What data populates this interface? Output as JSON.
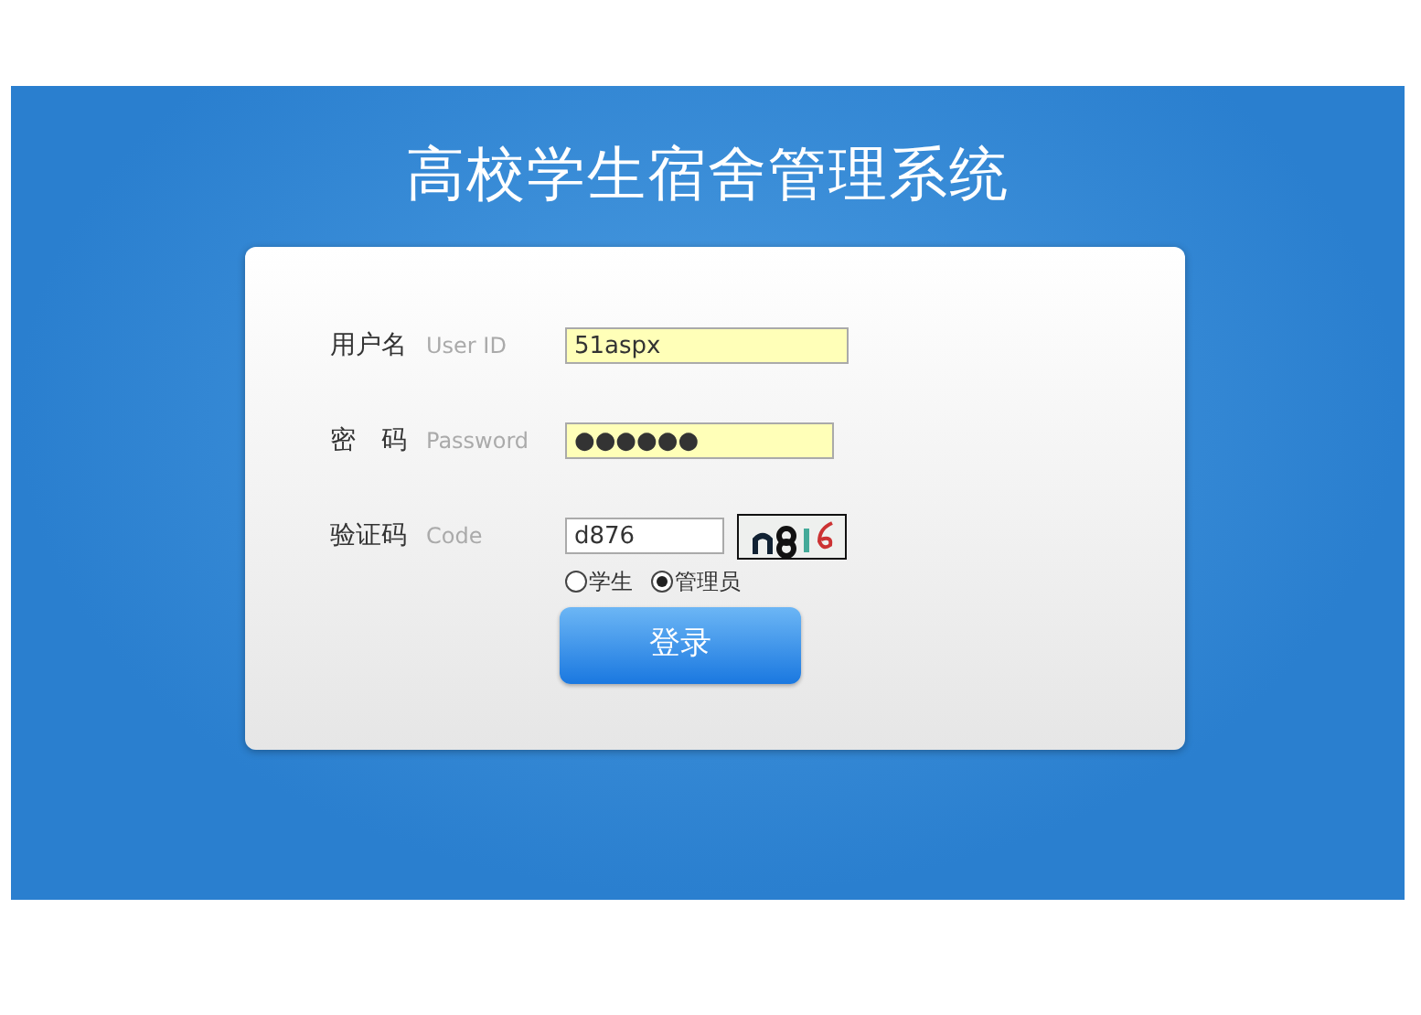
{
  "title": "高校学生宿舍管理系统",
  "fields": [
    {
      "label": "用户名",
      "hint": "User ID",
      "value": "51aspx",
      "highlighted": true,
      "kind": "text"
    },
    {
      "label": "密　码",
      "hint": "Password",
      "value": "●●●●●●",
      "highlighted": true,
      "kind": "password"
    },
    {
      "label": "验证码",
      "hint": "Code",
      "value": "d876",
      "highlighted": false,
      "kind": "captcha"
    }
  ],
  "roles": [
    {
      "label": "学生",
      "selected": false
    },
    {
      "label": "管理员",
      "selected": true
    }
  ],
  "login_button": "登录"
}
